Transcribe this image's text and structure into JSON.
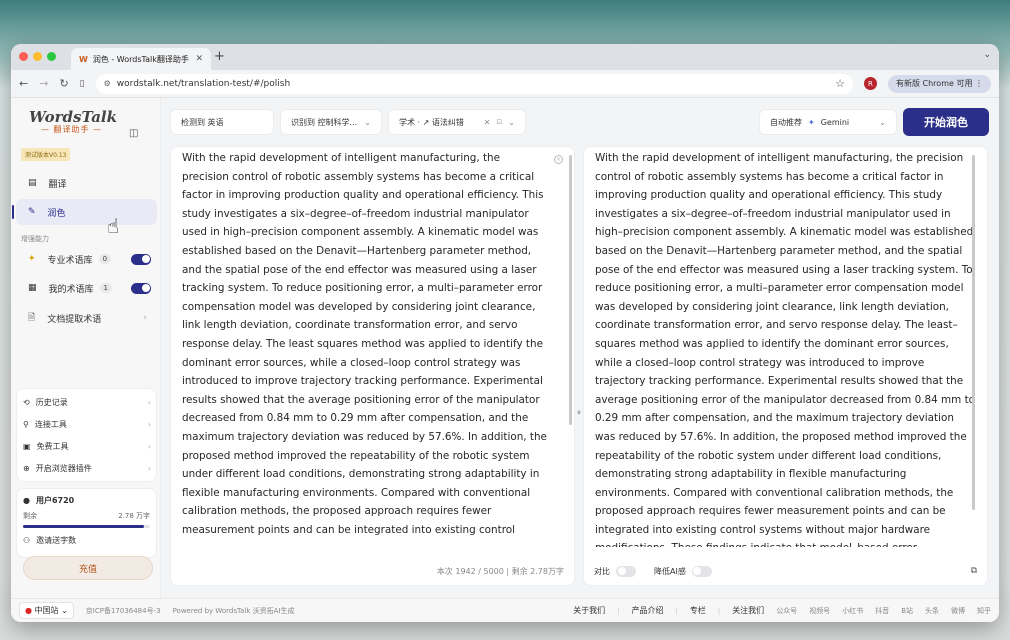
{
  "browser": {
    "tab_title": "润色 - WordsTalk翻译助手",
    "url": "wordstalk.net/translation-test/#/polish",
    "profile_initial": "R",
    "update_label": "有新版 Chrome 可用"
  },
  "sidebar": {
    "logo_text": "WordsTalk",
    "logo_sub": "— 翻译助手 —",
    "version": "测试版本V0.13",
    "nav": [
      {
        "label": "翻译"
      },
      {
        "label": "润色"
      }
    ],
    "section_label": "增强能力",
    "features": [
      {
        "label": "专业术语库",
        "count": "0"
      },
      {
        "label": "我的术语库",
        "count": "1"
      },
      {
        "label": "文档提取术语"
      }
    ],
    "menu": [
      {
        "label": "历史记录"
      },
      {
        "label": "连接工具"
      },
      {
        "label": "免费工具"
      },
      {
        "label": "开启浏览器插件"
      }
    ],
    "user": {
      "name": "用户6720",
      "remain_label": "剩余",
      "remain_value": "2.78 万字",
      "remain_fraction": 0.95,
      "invite_label": "邀请送字数"
    },
    "recharge_label": "充值"
  },
  "toolbar": {
    "detect_lang": "检测到 英语",
    "detect_domain": "识别到 控制科学...",
    "style_label": "学术 · ↗ 语法纠错",
    "auto_label": "自动推荐",
    "model": "Gemini",
    "start_label": "开始润色"
  },
  "source_text": "With the rapid development of intelligent manufacturing, the precision control of robotic assembly systems has become a critical factor in improving production quality and operational efficiency. This study investigates a six–degree–of–freedom industrial manipulator used in high–precision component assembly. A kinematic model was established based on the Denavit—Hartenberg parameter method, and the spatial pose of the end effector was measured using a laser tracking system. To reduce positioning error, a multi–parameter error compensation model was developed by considering joint clearance, link length deviation, coordinate transformation error, and servo response delay. The least squares method was applied to identify the dominant error sources, while a closed–loop control strategy was introduced to improve trajectory tracking performance. Experimental results showed that the average positioning error of the manipulator decreased from 0.84 mm to 0.29 mm after compensation, and the maximum trajectory deviation was reduced by 57.6%. In addition, the proposed method improved the repeatability of the robotic system under different load conditions, demonstrating strong adaptability in flexible manufacturing environments. Compared with conventional calibration methods, the proposed approach requires fewer measurement points and can be integrated into existing control",
  "result_text": "With the rapid development of intelligent manufacturing, the precision control of robotic assembly systems has become a critical factor in improving production quality and operational efficiency. This study investigates a six–degree–of–freedom industrial manipulator used in high–precision component assembly. A kinematic model was established based on the Denavit—Hartenberg parameter method, and the spatial pose of the end effector was measured using a laser tracking system. To reduce positioning error, a multi–parameter error compensation model was developed by considering joint clearance, link length deviation, coordinate transformation error, and servo response delay. The least–squares method was applied to identify the dominant error sources, while a closed–loop control strategy was introduced to improve trajectory tracking performance. Experimental results showed that the average positioning error of the manipulator decreased from 0.84 mm to 0.29 mm after compensation, and the maximum trajectory deviation was reduced by 57.6%. In addition, the proposed method improved the repeatability of the robotic system under different load conditions, demonstrating strong adaptability in flexible manufacturing environments. Compared with conventional calibration methods, the proposed approach requires fewer measurement points and can be integrated into existing control systems without major hardware modifications. These findings indicate that model–based error",
  "source_footer": "本次 1942 / 5000 | 剩余 2.78万字",
  "result_footer": {
    "compare": "对比",
    "reduce_ai": "降低AI感"
  },
  "footer": {
    "region": "中国站",
    "icp": "京ICP备17036484号-3",
    "powered": "Powered by WordsTalk 沃资拓AI生成",
    "links": [
      "关于我们",
      "产品介绍",
      "专栏",
      "关注我们"
    ],
    "social": [
      "公众号",
      "视频号",
      "小红书",
      "抖音",
      "B站",
      "头条",
      "微博",
      "知乎"
    ]
  },
  "colors": {
    "accent": "#2b2f8a",
    "brand_orange": "#c85a1e"
  }
}
